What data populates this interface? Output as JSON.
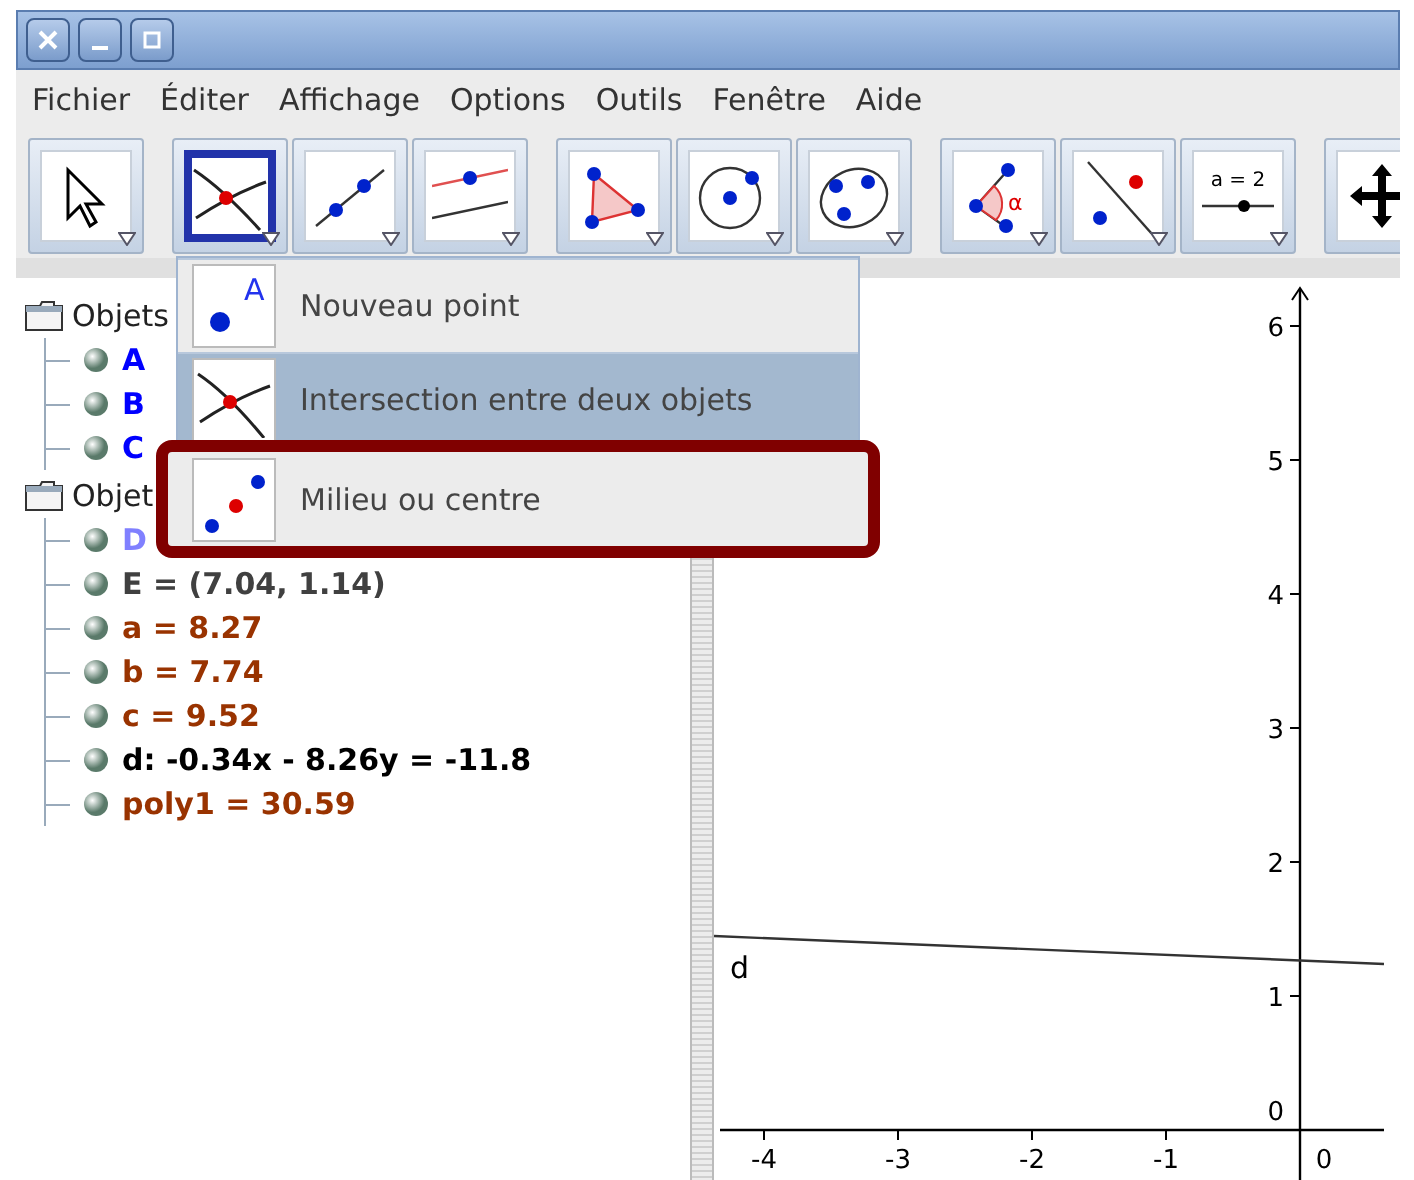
{
  "menu": [
    "Fichier",
    "Éditer",
    "Affichage",
    "Options",
    "Outils",
    "Fenêtre",
    "Aide"
  ],
  "toolbar": {
    "groups": [
      [
        {
          "kind": "move",
          "selected": false
        }
      ],
      [
        {
          "kind": "intersect",
          "selected": true
        },
        {
          "kind": "line",
          "selected": false
        },
        {
          "kind": "parallel",
          "selected": false
        }
      ],
      [
        {
          "kind": "polygon",
          "selected": false
        },
        {
          "kind": "circle",
          "selected": false
        },
        {
          "kind": "conic",
          "selected": false
        }
      ],
      [
        {
          "kind": "angle",
          "selected": false,
          "label": "α"
        },
        {
          "kind": "reflect",
          "selected": false
        },
        {
          "kind": "slider",
          "selected": false,
          "label": "a = 2"
        }
      ],
      [
        {
          "kind": "pan",
          "selected": false
        }
      ]
    ]
  },
  "popup": {
    "items": [
      {
        "kind": "point",
        "label": "Nouveau point",
        "icon_label": "A",
        "selected": false,
        "outlined": false
      },
      {
        "kind": "intersect",
        "label": "Intersection entre deux objets",
        "selected": true,
        "outlined": false
      },
      {
        "kind": "midpoint",
        "label": "Milieu ou centre",
        "selected": false,
        "outlined": true
      }
    ]
  },
  "algebra": {
    "groups": [
      {
        "label": "Objets",
        "children": [
          {
            "label": "A",
            "color": "#0000ff"
          },
          {
            "label": "B",
            "color": "#0000ff"
          },
          {
            "label": "C",
            "color": "#0000ff"
          }
        ]
      },
      {
        "label": "Objet",
        "children": [
          {
            "label": "D",
            "color": "#8080ff"
          },
          {
            "label": "E = (7.04, 1.14)",
            "color": "#404040"
          },
          {
            "label": "a = 8.27",
            "color": "#993300"
          },
          {
            "label": "b = 7.74",
            "color": "#993300"
          },
          {
            "label": "c = 9.52",
            "color": "#993300"
          },
          {
            "label": "d: -0.34x - 8.26y = -11.8",
            "color": "#000000"
          },
          {
            "label": "poly1 = 30.59",
            "color": "#993300"
          }
        ]
      }
    ]
  },
  "graphics": {
    "line_label": "d",
    "x_ticks": [
      "-4",
      "-3",
      "-2",
      "-1",
      "0"
    ],
    "y_ticks": [
      "6",
      "5",
      "4",
      "3",
      "2",
      "1",
      "0"
    ]
  }
}
